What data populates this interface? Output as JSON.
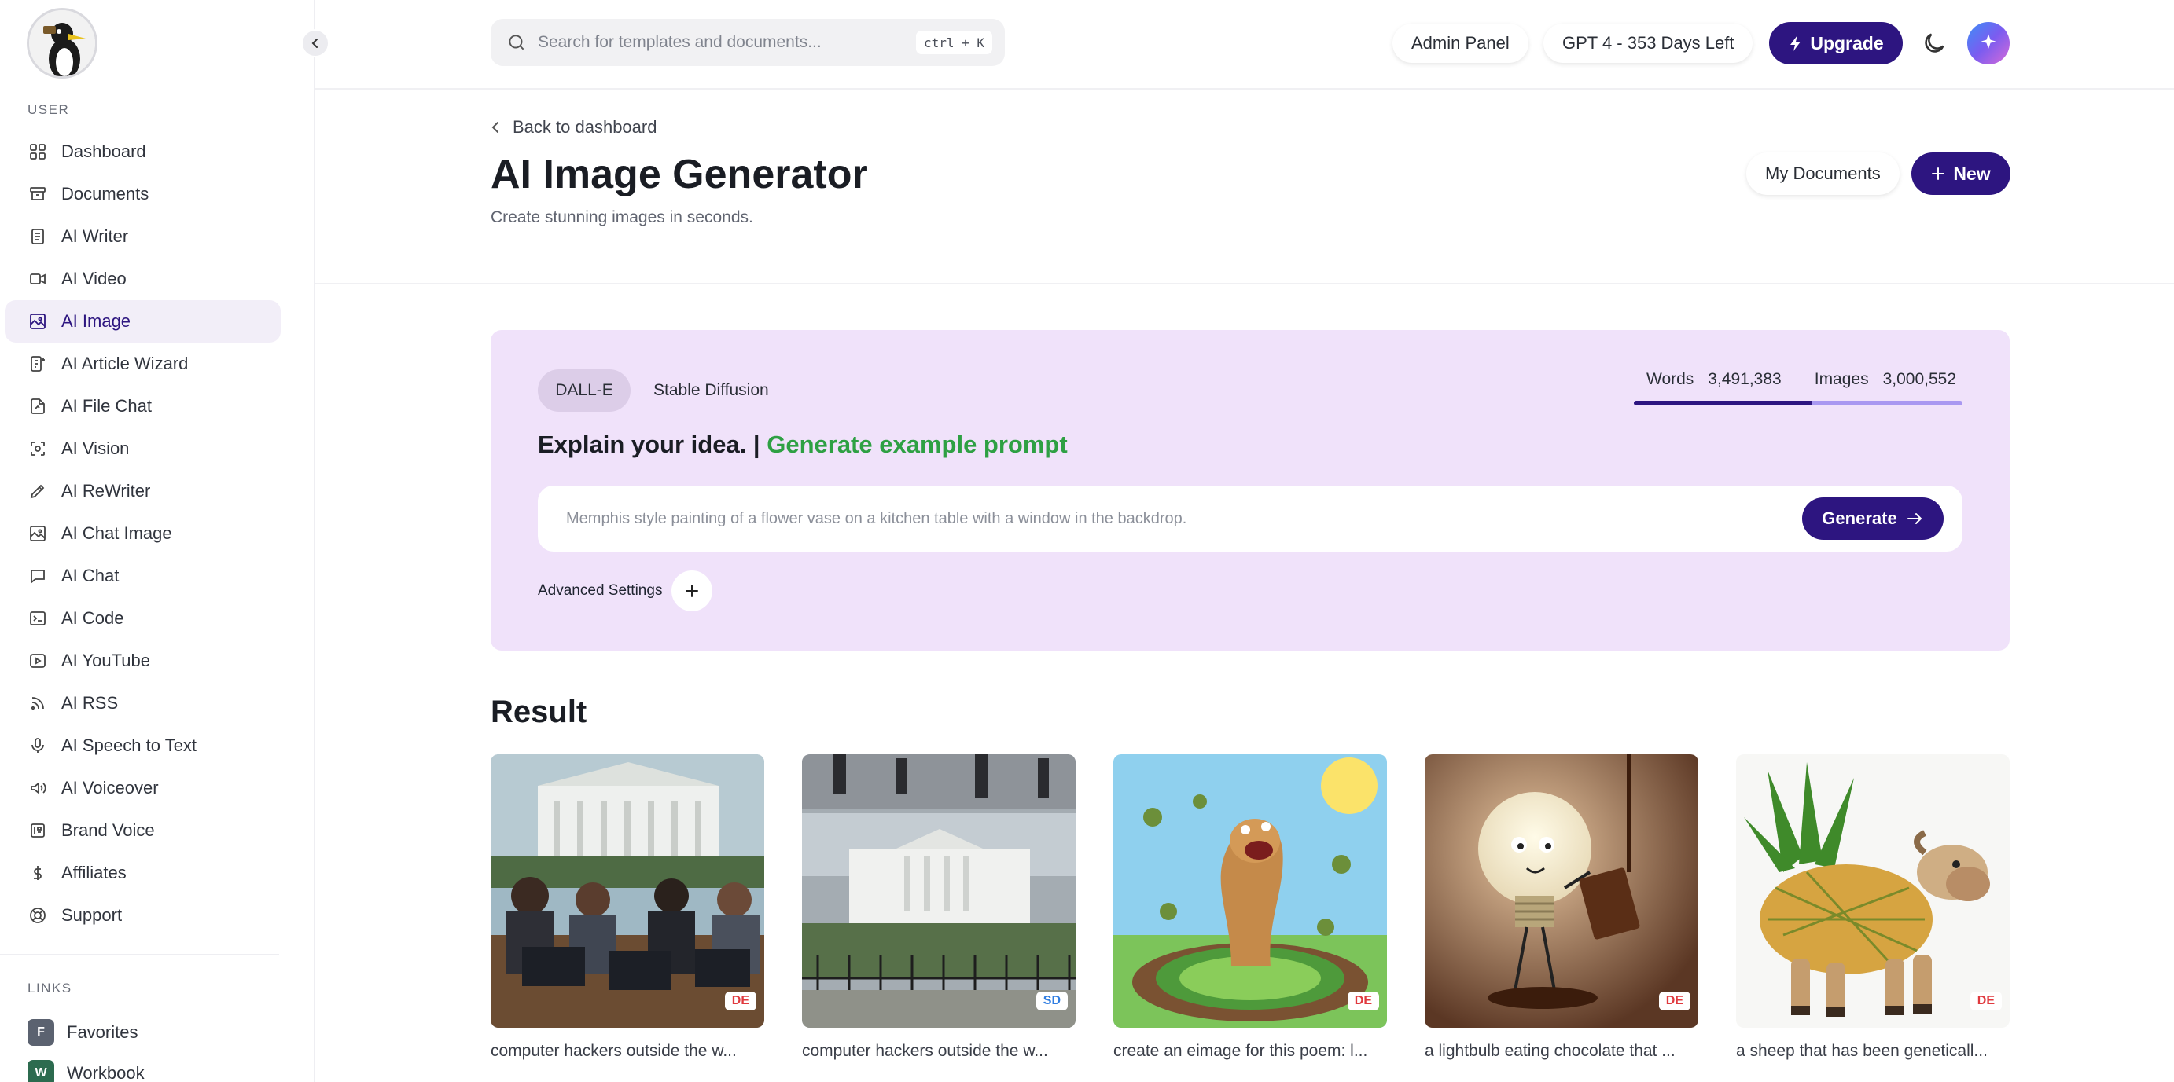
{
  "sidebar": {
    "user_section_label": "USER",
    "links_section_label": "LINKS",
    "items": [
      {
        "label": "Dashboard",
        "icon": "grid-icon"
      },
      {
        "label": "Documents",
        "icon": "archive-icon"
      },
      {
        "label": "AI Writer",
        "icon": "file-text-icon"
      },
      {
        "label": "AI Video",
        "icon": "video-icon"
      },
      {
        "label": "AI Image",
        "icon": "image-icon"
      },
      {
        "label": "AI Article Wizard",
        "icon": "wizard-icon"
      },
      {
        "label": "AI File Chat",
        "icon": "file-chat-icon"
      },
      {
        "label": "AI Vision",
        "icon": "scan-icon"
      },
      {
        "label": "AI ReWriter",
        "icon": "pen-icon"
      },
      {
        "label": "AI Chat Image",
        "icon": "chat-image-icon"
      },
      {
        "label": "AI Chat",
        "icon": "chat-icon"
      },
      {
        "label": "AI Code",
        "icon": "terminal-icon"
      },
      {
        "label": "AI YouTube",
        "icon": "youtube-icon"
      },
      {
        "label": "AI RSS",
        "icon": "rss-icon"
      },
      {
        "label": "AI Speech to Text",
        "icon": "microphone-icon"
      },
      {
        "label": "AI Voiceover",
        "icon": "speaker-icon"
      },
      {
        "label": "Brand Voice",
        "icon": "brand-icon"
      },
      {
        "label": "Affiliates",
        "icon": "dollar-icon"
      },
      {
        "label": "Support",
        "icon": "lifebuoy-icon"
      }
    ],
    "active_item": "AI Image",
    "links": [
      {
        "badge": "F",
        "label": "Favorites"
      },
      {
        "badge": "W",
        "label": "Workbook"
      }
    ]
  },
  "topbar": {
    "search_placeholder": "Search for templates and documents...",
    "search_shortcut": "ctrl + K",
    "admin_panel": "Admin Panel",
    "plan_status": "GPT 4 - 353 Days Left",
    "upgrade": "Upgrade"
  },
  "header": {
    "back": "Back to dashboard",
    "title": "AI Image Generator",
    "subtitle": "Create stunning images in seconds.",
    "my_documents": "My Documents",
    "new": "New"
  },
  "generator": {
    "tab_dalle": "DALL-E",
    "tab_sd": "Stable Diffusion",
    "words_label": "Words",
    "words_value": "3,491,383",
    "images_label": "Images",
    "images_value": "3,000,552",
    "words_fraction": 0.54,
    "explain": "Explain your idea. |",
    "generate_example": "Generate example prompt",
    "prompt_placeholder": "Memphis style painting of a flower vase on a kitchen table with a window in the backdrop.",
    "generate": "Generate",
    "advanced": "Advanced Settings"
  },
  "results": {
    "title": "Result",
    "items": [
      {
        "caption": "computer hackers outside the w...",
        "badge": "DE"
      },
      {
        "caption": "computer hackers outside the w...",
        "badge": "SD"
      },
      {
        "caption": "create an eimage for this poem: l...",
        "badge": "DE"
      },
      {
        "caption": "a lightbulb eating chocolate that ...",
        "badge": "DE"
      },
      {
        "caption": "a sheep that has been geneticall...",
        "badge": "DE"
      }
    ]
  },
  "colors": {
    "brand": "#2d1580",
    "panel_bg": "#f0e2fa",
    "accent_green": "#2ea043",
    "images_dot": "#a998f1"
  }
}
